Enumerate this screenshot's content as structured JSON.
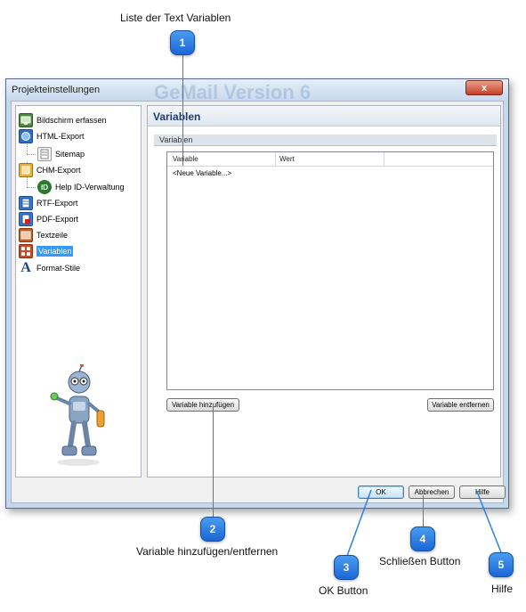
{
  "annotations": {
    "list_title": "Liste der Text Variablen",
    "add_remove": "Variable hinzufügen/entfernen",
    "ok": "OK Button",
    "close": "Schließen Button",
    "help": "Hilfe"
  },
  "badges": [
    "1",
    "2",
    "3",
    "4",
    "5"
  ],
  "window": {
    "title": "Projekteinstellungen",
    "ghost_title": "GeMail Version 6",
    "close_glyph": "x"
  },
  "tree": {
    "items": [
      {
        "label": "Bildschirm erfassen",
        "icon": "screen-capture-icon"
      },
      {
        "label": "HTML-Export",
        "icon": "html-export-icon"
      },
      {
        "label": "Sitemap",
        "icon": "sitemap-icon"
      },
      {
        "label": "CHM-Export",
        "icon": "chm-export-icon"
      },
      {
        "label": "Help ID-Verwaltung",
        "icon": "help-id-icon",
        "glyph": "ID"
      },
      {
        "label": "RTF-Export",
        "icon": "rtf-export-icon"
      },
      {
        "label": "PDF-Export",
        "icon": "pdf-export-icon"
      },
      {
        "label": "Textzeile",
        "icon": "textline-icon"
      },
      {
        "label": "Variablen",
        "icon": "variables-icon",
        "selected": true
      },
      {
        "label": "Format-Stile",
        "icon": "format-styles-icon",
        "glyph": "A"
      }
    ]
  },
  "panel": {
    "title": "Variablen",
    "section": "Variablen",
    "columns": [
      "Variable",
      "Wert"
    ],
    "rows": [
      "<Neue Variable...>"
    ],
    "add_button": "Variable hinzufügen",
    "remove_button": "Variable entfernen"
  },
  "footer": {
    "ok": "OK",
    "cancel": "Abbrechen",
    "help": "Hilfe"
  },
  "colors": {
    "accent": "#3399ff",
    "badge": "#1a66d6",
    "window_frame": "#c6d8ec"
  }
}
